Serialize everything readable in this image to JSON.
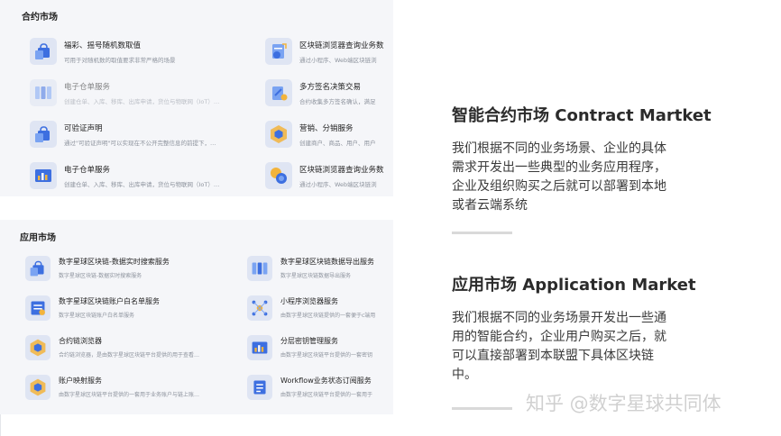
{
  "contract_market": {
    "title": "合约市场",
    "items": [
      {
        "name": "福彩、摇号随机数取值",
        "desc": "可用于对随机数的取值要求非常严格的场景",
        "icon": "lock-bag-icon"
      },
      {
        "name": "区块链浏览器查询业务数",
        "desc": "通过小程序、Web端区块链浏",
        "icon": "document-check-icon"
      },
      {
        "name": "电子仓单服务",
        "desc": "创建仓单、入库、移库、出库申请，货位与物联网（IoT）…",
        "icon": "blocks-icon"
      },
      {
        "name": "多方签名决策交易",
        "desc": "合约收集多方签名确认，满足",
        "icon": "signature-icon"
      },
      {
        "name": "可验证声明",
        "desc": "通过\"可验证声明\"可以实现在不公开完整信息的前提下，…",
        "icon": "lock-bag-icon"
      },
      {
        "name": "营销、分销服务",
        "desc": "创建商户、商品、用户、用户",
        "icon": "hex-network-icon"
      },
      {
        "name": "电子仓单服务",
        "desc": "创建仓单、入库、移库、出库申请，货位与物联网（IoT）…",
        "icon": "chart-card-icon"
      },
      {
        "name": "区块链浏览器查询业务数",
        "desc": "通过小程序、Web端区块链浏",
        "icon": "coins-icon"
      }
    ]
  },
  "app_market": {
    "title": "应用市场",
    "items": [
      {
        "name": "数字星球区块链-数据实时搜索服务",
        "desc": "数字星球区块链-数据实时搜索服务",
        "icon": "lock-bag-icon"
      },
      {
        "name": "数字星球区块链数据导出服务",
        "desc": "数字星球区块链数据导出服务",
        "icon": "blocks-icon"
      },
      {
        "name": "数字星球区块链账户白名单服务",
        "desc": "数字星球区块链账户白名单服务",
        "icon": "list-card-icon"
      },
      {
        "name": "小程序浏览器服务",
        "desc": "由数字星球区块链提供的一套便于c端用",
        "icon": "network-icon"
      },
      {
        "name": "合约链浏览器",
        "desc": "合约链浏览器，是由数字星球区块链平台提供的用于查看…",
        "icon": "hex-network-icon"
      },
      {
        "name": "分层密钥管理服务",
        "desc": "由数字星球区块链平台提供的一套密钥",
        "icon": "chart-card-icon"
      },
      {
        "name": "账户映射服务",
        "desc": "由数字星球区块链平台提供的一套用于业务账户与链上账…",
        "icon": "hex-network-icon"
      },
      {
        "name": "Workflow业务状态订阅服务",
        "desc": "由数字星球区块链平台提供的一套用于",
        "icon": "document-icon"
      }
    ]
  },
  "right": {
    "heading1": "智能合约市场 Contract Martket",
    "para1": "我们根据不同的业务场景、企业的具体需求开发出一些典型的业务应用程序，企业及组织购买之后就可以部署到本地或者云端系统",
    "heading2": "应用市场 Application Market",
    "para2": "我们根据不同的业务场景开发出一些通用的智能合约，企业用户购买之后，就可以直接部署到本联盟下具体区块链中。"
  },
  "watermark": "知乎 @数字星球共同体",
  "colors": {
    "accent": "#3d6fe0",
    "panel_bg": "#f5f6f9",
    "icon_bg": "#dfe5f3",
    "gold": "#f3b43c"
  }
}
